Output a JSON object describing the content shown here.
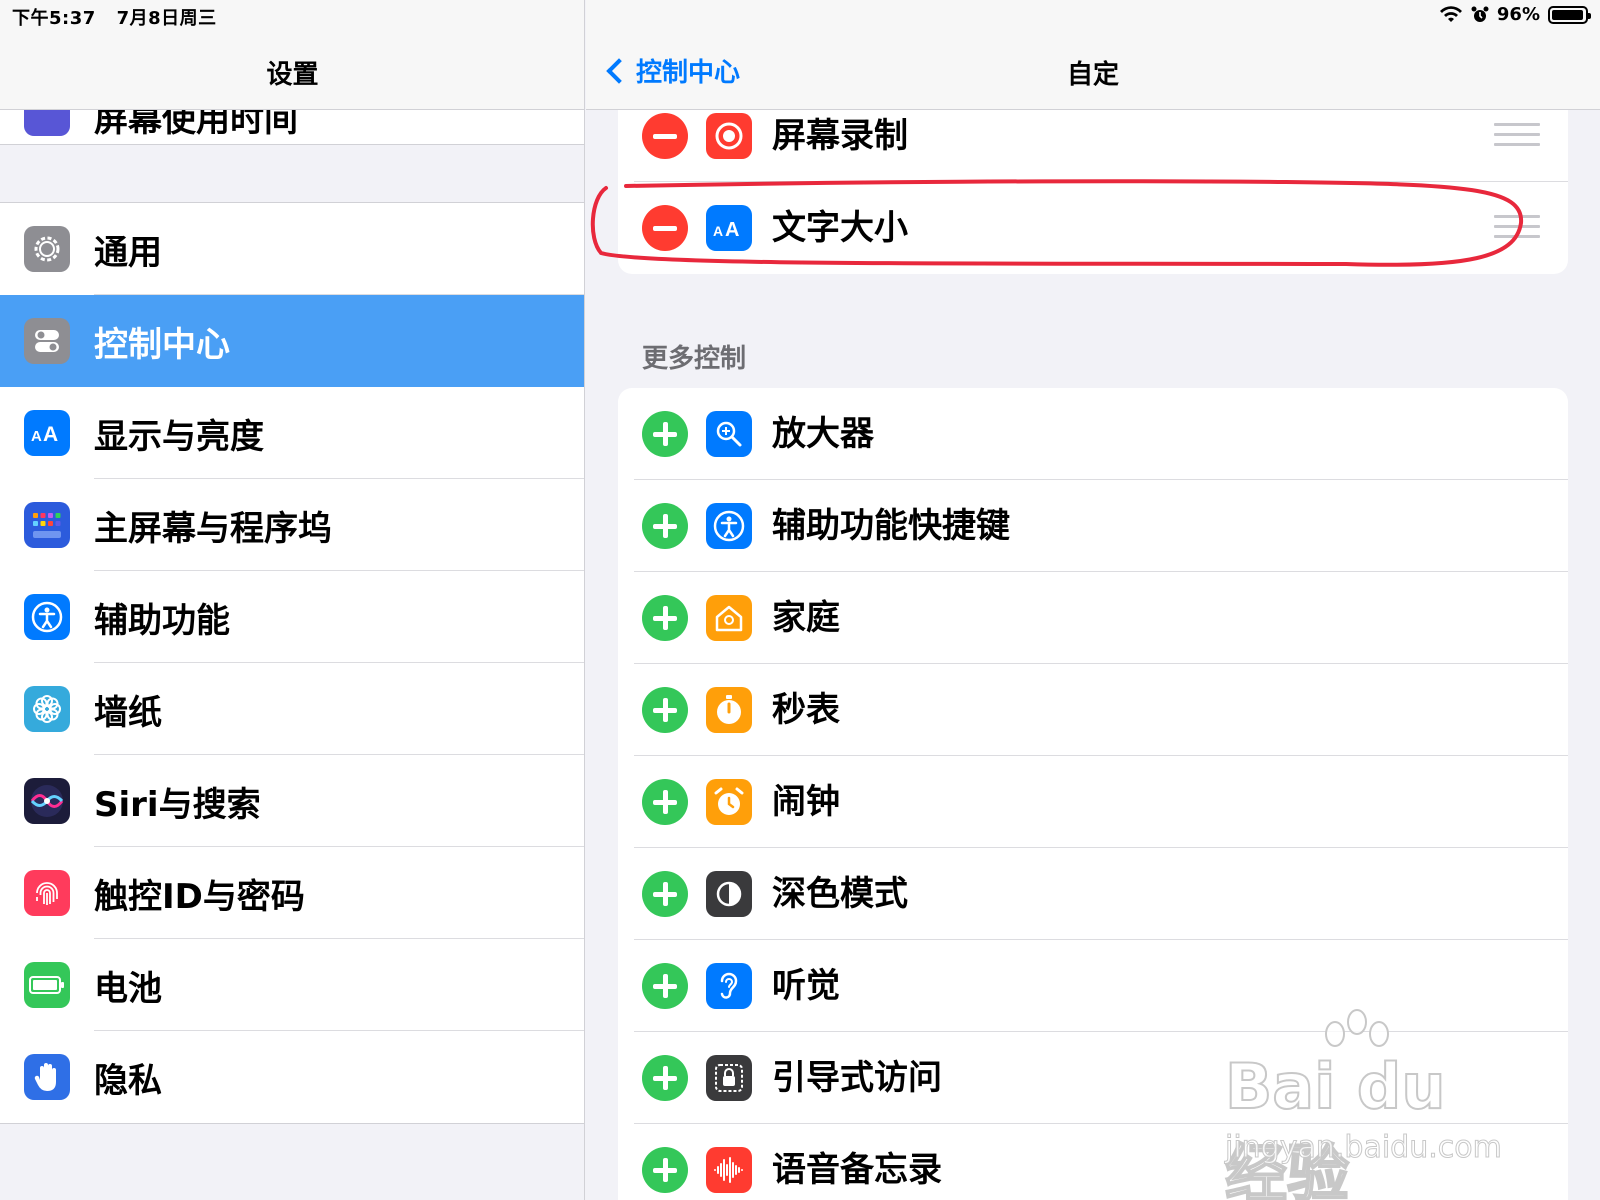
{
  "status_bar": {
    "time": "下午5:37",
    "date": "7月8日周三",
    "battery_text": "96%",
    "battery_level": 0.96
  },
  "left_pane": {
    "title": "设置",
    "partial_item_label": "屏幕使用时间",
    "items": [
      {
        "label": "通用",
        "icon": "gear-icon",
        "color": "#8e8e93"
      },
      {
        "label": "控制中心",
        "icon": "toggles-icon",
        "color": "#8e8e93",
        "selected": true
      },
      {
        "label": "显示与亮度",
        "icon": "text-size-icon",
        "color": "#007aff"
      },
      {
        "label": "主屏幕与程序坞",
        "icon": "app-grid-icon",
        "color": "#2c5bdc"
      },
      {
        "label": "辅助功能",
        "icon": "accessibility-icon",
        "color": "#007aff"
      },
      {
        "label": "墙纸",
        "icon": "flower-icon",
        "color": "#35aadc"
      },
      {
        "label": "Siri与搜索",
        "icon": "siri-icon",
        "color": "#1c1c3a"
      },
      {
        "label": "触控ID与密码",
        "icon": "fingerprint-icon",
        "color": "#ff3b5c"
      },
      {
        "label": "电池",
        "icon": "battery-icon",
        "color": "#34c759"
      },
      {
        "label": "隐私",
        "icon": "hand-icon",
        "color": "#2f6fe6"
      }
    ]
  },
  "right_pane": {
    "back_label": "控制中心",
    "title": "自定",
    "included": [
      {
        "label": "屏幕录制",
        "icon": "record-icon",
        "color": "#ff3b30"
      },
      {
        "label": "文字大小",
        "icon": "text-size-icon",
        "color": "#007aff",
        "icon_text": "AA"
      }
    ],
    "more_header": "更多控制",
    "more": [
      {
        "label": "放大器",
        "icon": "magnifier-icon",
        "color": "#007aff"
      },
      {
        "label": "辅助功能快捷键",
        "icon": "accessibility-icon",
        "color": "#007aff"
      },
      {
        "label": "家庭",
        "icon": "home-icon",
        "color": "#ff9f0a"
      },
      {
        "label": "秒表",
        "icon": "stopwatch-icon",
        "color": "#ff9f0a"
      },
      {
        "label": "闹钟",
        "icon": "alarm-icon",
        "color": "#ff9f0a"
      },
      {
        "label": "深色模式",
        "icon": "dark-mode-icon",
        "color": "#3a3a3c"
      },
      {
        "label": "听觉",
        "icon": "ear-icon",
        "color": "#007aff"
      },
      {
        "label": "引导式访问",
        "icon": "lock-icon",
        "color": "#3a3a3c"
      },
      {
        "label": "语音备忘录",
        "icon": "waveform-icon",
        "color": "#ff3b30"
      }
    ]
  },
  "annotation": {
    "color": "#e8283c"
  },
  "watermark": {
    "main": "Bai du 经验",
    "sub": "jingyan.baidu.com"
  }
}
